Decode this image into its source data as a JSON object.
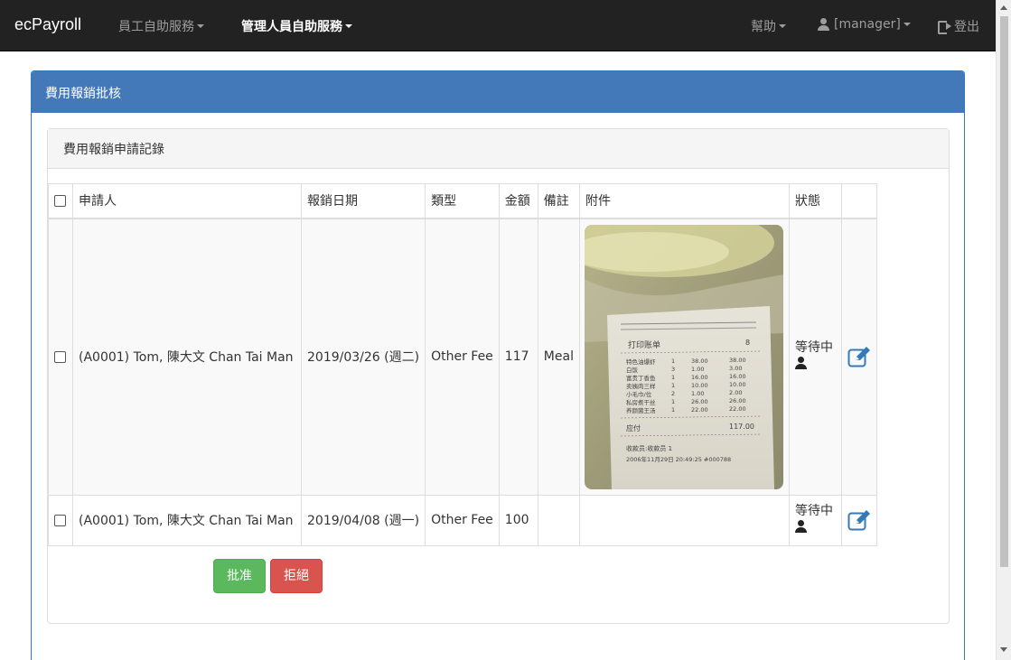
{
  "navbar": {
    "brand": "ecPayroll",
    "menu_employee": "員工自助服務",
    "menu_manager": "管理人員自助服務",
    "help": "幫助",
    "user": "[manager]",
    "logout": "登出"
  },
  "panel": {
    "title": "費用報銷批核",
    "subtitle": "費用報銷申請記錄"
  },
  "table": {
    "headers": [
      "申請人",
      "報銷日期",
      "類型",
      "金額",
      "備註",
      "附件",
      "狀態"
    ],
    "rows": [
      {
        "applicant": "(A0001) Tom, 陳大文 Chan Tai Man",
        "date": "2019/03/26 (週二)",
        "type": "Other Fee",
        "amount": "117",
        "remark": "Meal",
        "attachment": "receipt-image",
        "status": "等待中"
      },
      {
        "applicant": "(A0001) Tom, 陳大文 Chan Tai Man",
        "date": "2019/04/08 (週一)",
        "type": "Other Fee",
        "amount": "100",
        "remark": "",
        "attachment": "",
        "status": "等待中"
      }
    ]
  },
  "receipt": {
    "title": "打印账单",
    "lines": [
      [
        "特色油爆虾",
        "1",
        "38.00",
        "38.00"
      ],
      [
        "白饭",
        "3",
        "1.00",
        "3.00"
      ],
      [
        "富贵丁香鱼",
        "1",
        "16.00",
        "16.00"
      ],
      [
        "卖姨肉三样",
        "1",
        "10.00",
        "10.00"
      ],
      [
        "小毛巾/位",
        "2",
        "1.00",
        "2.00"
      ],
      [
        "私房煮干丝",
        "1",
        "26.00",
        "26.00"
      ],
      [
        "养颜菌王汤",
        "1",
        "22.00",
        "22.00"
      ]
    ],
    "total_label": "应付",
    "total": "117.00",
    "cashier": "收款员:收款员 1",
    "timestamp": "2006年11月29日 20:49:25 #000788"
  },
  "actions": {
    "approve": "批准",
    "reject": "拒絕"
  },
  "colors": {
    "navbar": "#222222",
    "panel_primary": "#4479b9",
    "success": "#5cb85c",
    "danger": "#d9534f",
    "edit_icon": "#337ab7"
  }
}
